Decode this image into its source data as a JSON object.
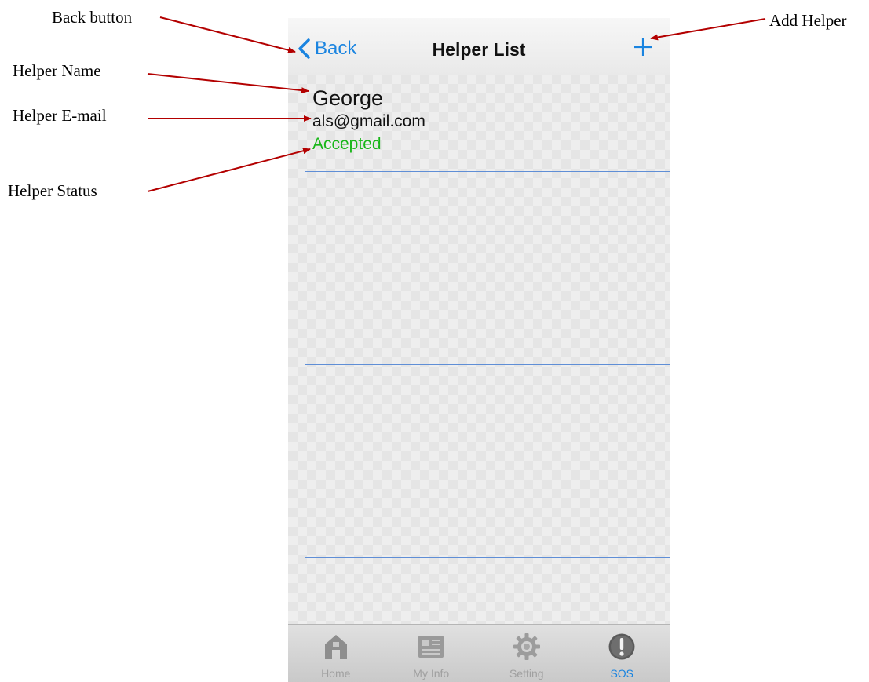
{
  "annotations": {
    "back_button": "Back button",
    "add_helper": "Add Helper",
    "helper_name": "Helper Name",
    "helper_email": "Helper E-mail",
    "helper_status": "Helper Status",
    "arrow_color": "#b30000"
  },
  "navbar": {
    "back_label": "Back",
    "title": "Helper List",
    "add_icon": "plus-icon",
    "accent_color": "#1a84e0"
  },
  "helpers": [
    {
      "name": "George",
      "email": "als@gmail.com",
      "status": "Accepted",
      "status_color": "#18b618"
    }
  ],
  "tabbar": {
    "tabs": [
      {
        "label": "Home",
        "icon": "home-icon",
        "active": false
      },
      {
        "label": "My Info",
        "icon": "document-icon",
        "active": false
      },
      {
        "label": "Setting",
        "icon": "gear-icon",
        "active": false
      },
      {
        "label": "SOS",
        "icon": "alert-icon",
        "active": true
      }
    ]
  }
}
